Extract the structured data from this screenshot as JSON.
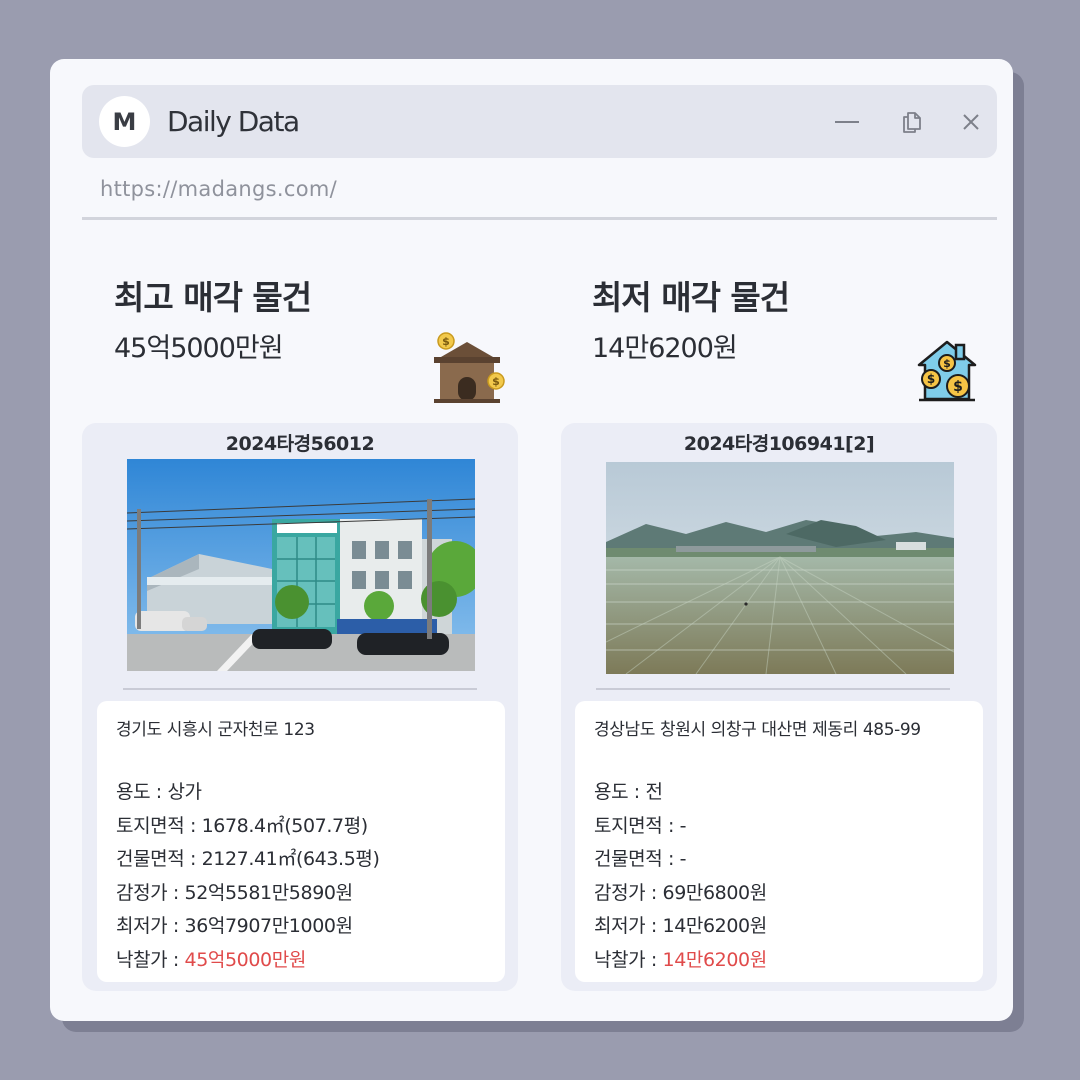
{
  "window": {
    "avatar_letter": "M",
    "title": "Daily Data",
    "url": "https://madangs.com/"
  },
  "highest": {
    "heading": "최고 매각 물건",
    "amount": "45억5000만원",
    "case_number": "2024타경56012",
    "address": "경기도 시흥시 군자천로 123",
    "rows": {
      "usage": "용도 : 상가",
      "land_area": "토지면적 : 1678.4㎡(507.7평)",
      "building_area": "건물면적 : 2127.41㎡(643.5평)",
      "appraisal": "감정가 : 52억5581만5890원",
      "minimum": "최저가 : 36억7907만1000원",
      "winning_label": "낙찰가 : ",
      "winning_value": "45억5000만원"
    }
  },
  "lowest": {
    "heading": "최저 매각 물건",
    "amount": "14만6200원",
    "case_number": "2024타경106941[2]",
    "address": "경상남도 창원시 의창구 대산면 제동리 485-99",
    "rows": {
      "usage": "용도 : 전",
      "land_area": "토지면적 : -",
      "building_area": "건물면적 : -",
      "appraisal": "감정가 : 69만6800원",
      "minimum": "최저가 : 14만6200원",
      "winning_label": "낙찰가 : ",
      "winning_value": "14만6200원"
    }
  },
  "icons": {
    "minimize": "minimize-icon",
    "restore": "restore-icon",
    "close": "close-icon",
    "house_money": "house-coins-icon",
    "home_money": "home-dollar-icon"
  },
  "colors": {
    "accent_red": "#e04b4b",
    "background": "#9a9caf",
    "window": "#f7f8fc"
  }
}
